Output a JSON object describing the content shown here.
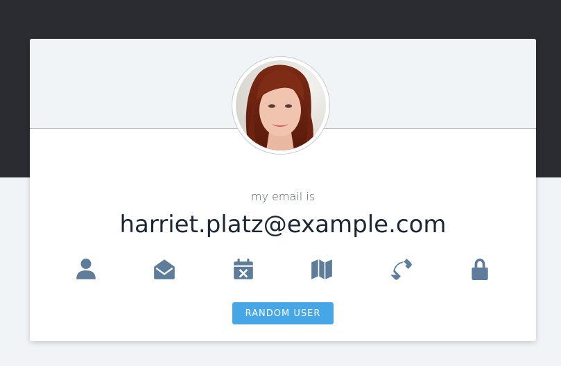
{
  "profile": {
    "subtitle": "my email is",
    "value": "harriet.platz@example.com"
  },
  "icons": [
    {
      "name": "user-icon",
      "active": false
    },
    {
      "name": "envelope-open-icon",
      "active": true
    },
    {
      "name": "calendar-icon",
      "active": false
    },
    {
      "name": "map-icon",
      "active": false
    },
    {
      "name": "phone-icon",
      "active": false
    },
    {
      "name": "lock-icon",
      "active": false
    }
  ],
  "button": {
    "label": "RANDOM USER"
  },
  "colors": {
    "top_band": "#2a2c31",
    "icon": "#5f7d9b",
    "button": "#46a6e6"
  }
}
